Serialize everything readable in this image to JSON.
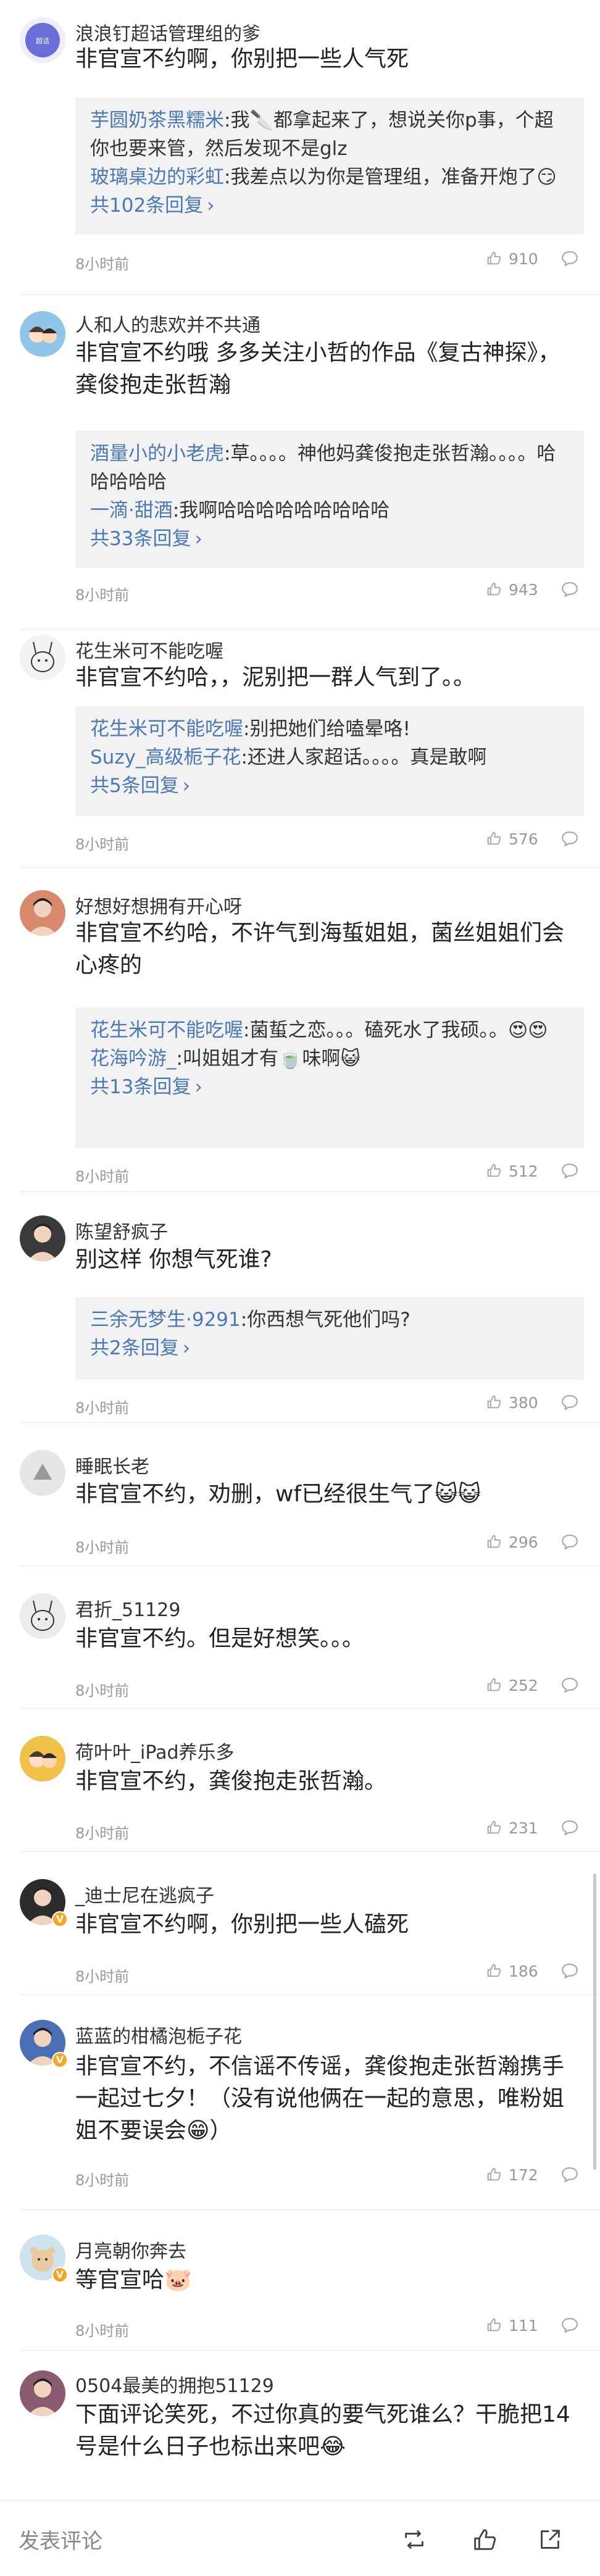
{
  "comments": [
    {
      "name": "浪浪钉超话管理组的爹",
      "text": "非官宣不约啊，你别把一些人气死",
      "replies": [
        {
          "user": "芋圆奶茶黑糯米",
          "text": ":我🔪都拿起来了，想说关你p事，个超你也要来管，然后发现不是glz"
        },
        {
          "user": "玻璃桌边的彩虹",
          "text": ":我差点以为你是管理组，准备开炮了😏"
        }
      ],
      "more": "共102条回复",
      "time": "8小时前",
      "likes": "910",
      "avatar_icon": "weibo-admin-avatar-icon",
      "avatar_color": "#6a6fd8"
    },
    {
      "name": "人和人的悲欢并不共通",
      "text": "非官宣不约哦 多多关注小哲的作品《复古神探》，龚俊抱走张哲瀚",
      "replies": [
        {
          "user": "酒量小的小老虎",
          "text": ":草。。。。神他妈龚俊抱走张哲瀚。。。。哈哈哈哈哈"
        },
        {
          "user": "一滴·甜酒",
          "text": ":我啊哈哈哈哈哈哈哈哈哈"
        }
      ],
      "more": "共33条回复",
      "time": "8小时前",
      "likes": "943",
      "avatar_icon": "cartoon-couple-avatar-icon",
      "avatar_color": "#8ec5e8"
    },
    {
      "name": "花生米可不能吃喔",
      "text": "非官宣不约哈，，泥别把一群人气到了。。",
      "replies": [
        {
          "user": "花生米可不能吃喔",
          "text": ":别把她们给嗑晕咯!"
        },
        {
          "user": "Suzy_高级栀子花",
          "text": ":还进人家超话。。。。真是敢啊"
        }
      ],
      "more": "共5条回复",
      "time": "8小时前",
      "likes": "576",
      "avatar_icon": "bunny-sketch-avatar-icon",
      "avatar_color": "#f3f3f3"
    },
    {
      "name": "好想好想拥有开心呀",
      "text": "非官宣不约哈，不许气到海蜇姐姐，菌丝姐姐们会心疼的",
      "replies": [
        {
          "user": "花生米可不能吃喔",
          "text": ":菌蜇之恋。。。磕死水了我硕。。😍😍"
        },
        {
          "user": "花海吟游_",
          "text": ":叫姐姐才有🍵味啊😺"
        }
      ],
      "more": "共13条回复",
      "time": "8小时前",
      "likes": "512",
      "avatar_icon": "portrait-avatar-icon",
      "avatar_color": "#d98a6d"
    },
    {
      "name": "陈望舒疯子",
      "text": "别这样 你想气死谁?",
      "replies": [
        {
          "user": "三余无梦生·9291",
          "text": ":你西想气死他们吗?"
        }
      ],
      "more": "共2条回复",
      "time": "8小时前",
      "likes": "380",
      "avatar_icon": "dark-photo-avatar-icon",
      "avatar_color": "#3a3a3a"
    },
    {
      "name": "睡眠长老",
      "text": "非官宣不约，劝删，wf已经很生气了😺😺",
      "replies": [],
      "more": "",
      "time": "8小时前",
      "likes": "296",
      "avatar_icon": "default-triangle-avatar-icon",
      "avatar_color": "#e0e0e0"
    },
    {
      "name": "君折_51129",
      "text": "非官宣不约。但是好想笑。。。",
      "replies": [],
      "more": "",
      "time": "8小时前",
      "likes": "252",
      "avatar_icon": "cat-sketch-avatar-icon",
      "avatar_color": "#ececec"
    },
    {
      "name": "荷叶叶_iPad养乐多",
      "text": "非官宣不约，龚俊抱走张哲瀚。",
      "replies": [],
      "more": "",
      "time": "8小时前",
      "likes": "231",
      "avatar_icon": "cartoon-avatar-icon",
      "avatar_color": "#f0c24a"
    },
    {
      "name": "_迪士尼在逃疯子",
      "text": "非官宣不约啊，你别把一些人磕死",
      "replies": [],
      "more": "",
      "time": "8小时前",
      "likes": "186",
      "avatar_icon": "portrait-avatar-icon",
      "avatar_color": "#2c2c2c",
      "verified": true
    },
    {
      "name": "蓝蓝的柑橘泡栀子花",
      "text": "非官宣不约，不信谣不传谣，龚俊抱走张哲瀚携手一起过七夕！（没有说他俩在一起的意思，唯粉姐姐不要误会😁）",
      "replies": [],
      "more": "",
      "time": "8小时前",
      "likes": "172",
      "avatar_icon": "portrait-avatar-icon",
      "avatar_color": "#4a6fb5",
      "verified": true
    },
    {
      "name": "月亮朝你奔去",
      "text": "等官宣哈🐷",
      "replies": [],
      "more": "",
      "time": "8小时前",
      "likes": "111",
      "avatar_icon": "bear-avatar-icon",
      "avatar_color": "#cfe3ef",
      "verified": true
    },
    {
      "name": "0504最美的拥抱51129",
      "text": "下面评论笑死，不过你真的要气死谁么？干脆把14号是什么日子也标出来吧😂",
      "replies": [],
      "more": "",
      "time": "",
      "likes": "",
      "avatar_icon": "portrait-avatar-icon",
      "avatar_color": "#8a5a70"
    }
  ],
  "bottom_bar": {
    "input_placeholder": "发表评论",
    "repost_icon": "repost-icon",
    "like_icon": "thumbs-up-icon",
    "share_icon": "share-icon"
  },
  "colors": {
    "link": "#4b79b8",
    "reply_bg": "#f2f2f2",
    "meta": "#999999"
  }
}
